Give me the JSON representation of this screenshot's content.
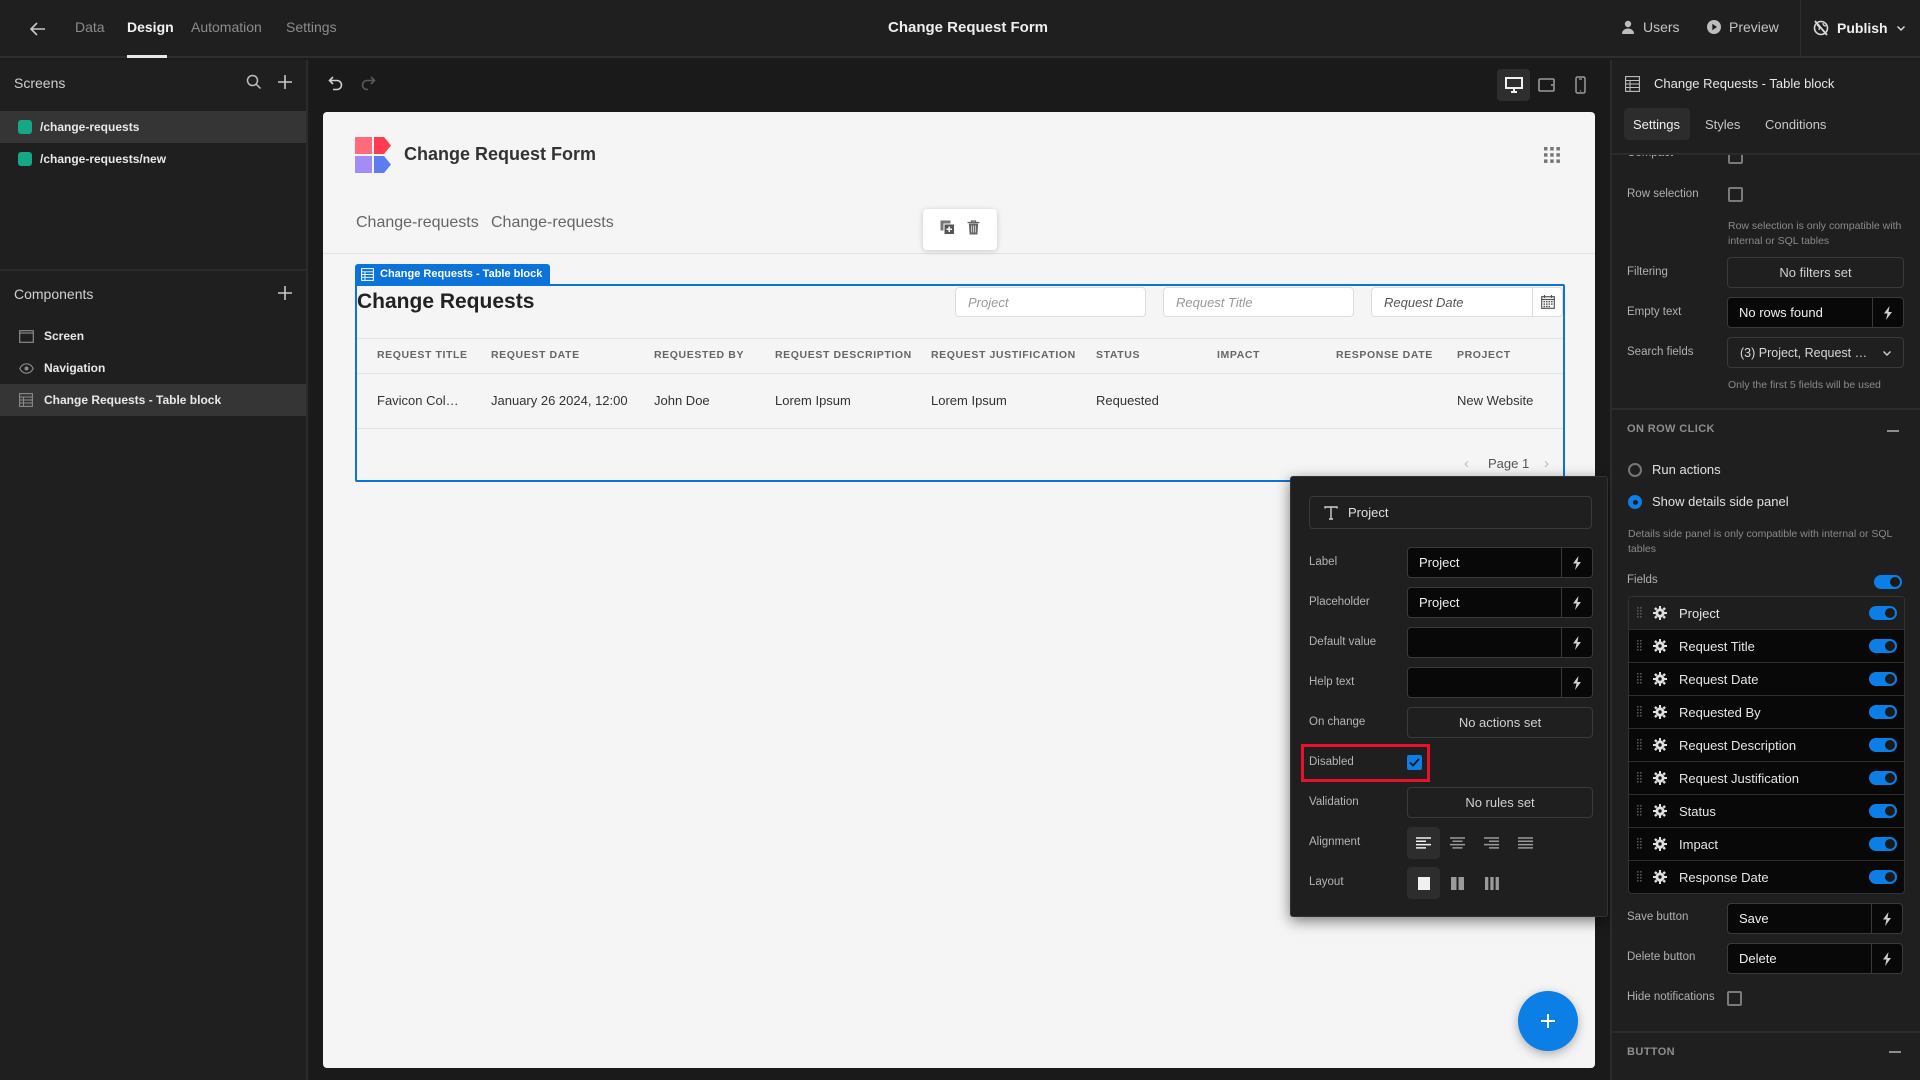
{
  "topbar": {
    "tabs": [
      {
        "label": "Data",
        "active": false
      },
      {
        "label": "Design",
        "active": true
      },
      {
        "label": "Automation",
        "active": false
      },
      {
        "label": "Settings",
        "active": false
      }
    ],
    "app_title": "Change Request Form",
    "users_label": "Users",
    "preview_label": "Preview",
    "publish_label": "Publish"
  },
  "sidebar": {
    "screens_title": "Screens",
    "screens": [
      {
        "label": "/change-requests",
        "selected": true
      },
      {
        "label": "/change-requests/new",
        "selected": false
      }
    ],
    "components_title": "Components",
    "components": [
      {
        "label": "Screen",
        "icon": "screen-icon",
        "selected": false
      },
      {
        "label": "Navigation",
        "icon": "eye-icon",
        "selected": false
      },
      {
        "label": "Change Requests - Table block",
        "icon": "table-icon",
        "selected": true
      }
    ]
  },
  "canvas": {
    "device_modes": [
      "desktop",
      "tablet",
      "mobile"
    ],
    "active_device": "desktop",
    "app": {
      "name": "Change Request Form",
      "nav_links": [
        "Change-requests",
        "Change-requests"
      ],
      "block_tag": "Change Requests - Table block",
      "table_title": "Change Requests",
      "search_placeholders": [
        "Project",
        "Request Title",
        "Request Date"
      ],
      "columns": [
        "REQUEST TITLE",
        "REQUEST DATE",
        "REQUESTED BY",
        "REQUEST DESCRIPTION",
        "REQUEST JUSTIFICATION",
        "STATUS",
        "IMPACT",
        "RESPONSE DATE",
        "PROJECT"
      ],
      "rows": [
        [
          "Favicon Col…",
          "January 26 2024, 12:00",
          "John Doe",
          "Lorem Ipsum",
          "Lorem Ipsum",
          "Requested",
          "",
          "",
          "New Website"
        ]
      ],
      "pagination_label": "Page 1"
    }
  },
  "popover": {
    "field_type_label": "Project",
    "label_label": "Label",
    "label_value": "Project",
    "placeholder_label": "Placeholder",
    "placeholder_value": "Project",
    "default_label": "Default value",
    "default_value": "",
    "help_label": "Help text",
    "help_value": "",
    "onchange_label": "On change",
    "onchange_value": "No actions set",
    "disabled_label": "Disabled",
    "disabled_checked": true,
    "validation_label": "Validation",
    "validation_value": "No rules set",
    "alignment_label": "Alignment",
    "alignment_selected": "left",
    "layout_label": "Layout",
    "layout_selected": "single-column",
    "highlight_color": "#e8112d"
  },
  "rpanel": {
    "title": "Change Requests - Table block",
    "tabs": [
      "Settings",
      "Styles",
      "Conditions"
    ],
    "active_tab": "Settings",
    "compact_label": "Compact",
    "row_selection_label": "Row selection",
    "row_selection_help": "Row selection is only compatible with internal or SQL tables",
    "filtering_label": "Filtering",
    "filtering_value": "No filters set",
    "empty_text_label": "Empty text",
    "empty_text_value": "No rows found",
    "search_fields_label": "Search fields",
    "search_fields_value": "(3) Project, Request …",
    "search_fields_help": "Only the first 5 fields will be used",
    "on_row_click_title": "ON ROW CLICK",
    "run_actions_label": "Run actions",
    "show_details_label": "Show details side panel",
    "selected_row_click": "show_details",
    "details_help": "Details side panel is only compatible with internal or SQL tables",
    "fields_label": "Fields",
    "fields": [
      {
        "label": "Project",
        "enabled": true
      },
      {
        "label": "Request Title",
        "enabled": true
      },
      {
        "label": "Request Date",
        "enabled": true
      },
      {
        "label": "Requested By",
        "enabled": true
      },
      {
        "label": "Request Description",
        "enabled": true
      },
      {
        "label": "Request Justification",
        "enabled": true
      },
      {
        "label": "Status",
        "enabled": true
      },
      {
        "label": "Impact",
        "enabled": true
      },
      {
        "label": "Response Date",
        "enabled": true
      }
    ],
    "save_button_label": "Save button",
    "save_button_value": "Save",
    "delete_button_label": "Delete button",
    "delete_button_value": "Delete",
    "hide_notifications_label": "Hide notifications",
    "button_section_title": "BUTTON"
  },
  "colors": {
    "accent": "#0b73da",
    "screen_dot": "#13a886"
  }
}
